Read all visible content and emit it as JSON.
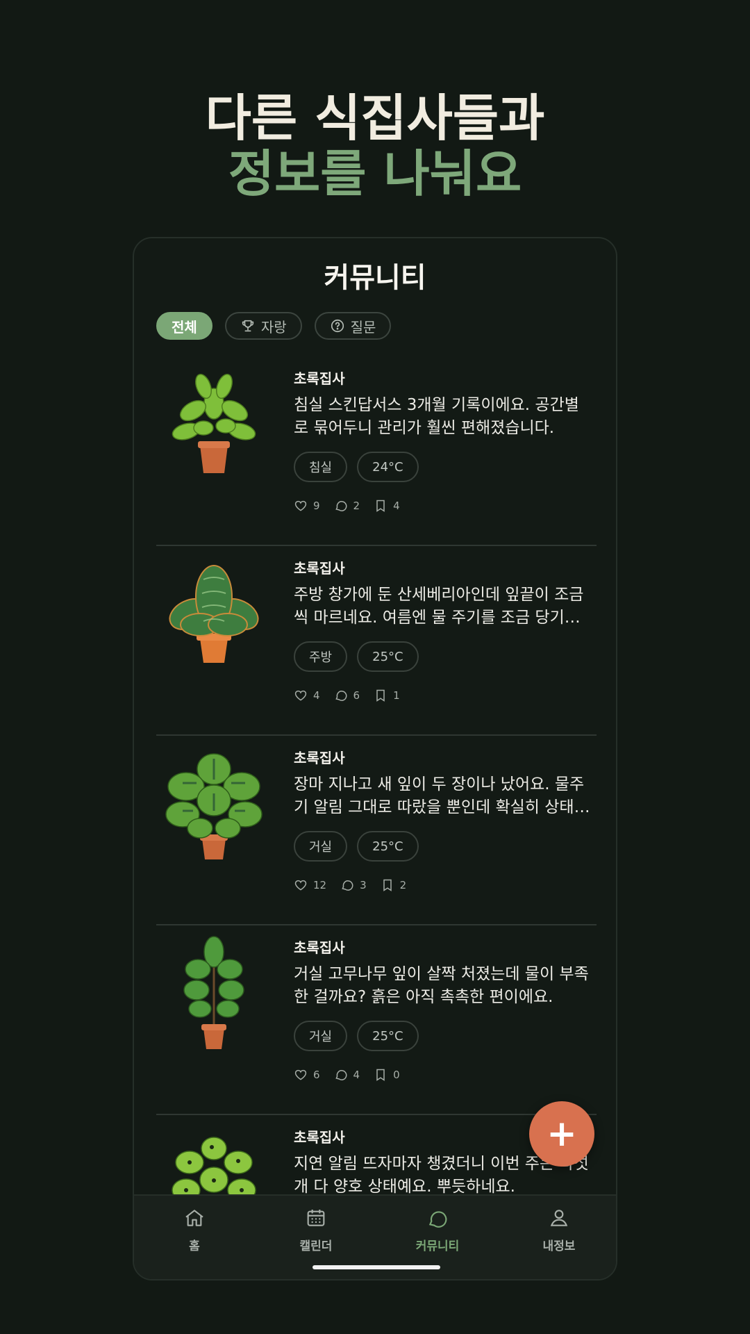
{
  "headline": {
    "line1": "다른 식집사들과",
    "line2": "정보를 나눠요"
  },
  "screen": {
    "title": "커뮤니티"
  },
  "filters": [
    {
      "label": "전체",
      "icon": "",
      "active": true
    },
    {
      "label": "자랑",
      "icon": "trophy-icon",
      "active": false
    },
    {
      "label": "질문",
      "icon": "question-icon",
      "active": false
    }
  ],
  "posts": [
    {
      "author": "초록집사",
      "body": "침실 스킨답서스 3개월 기록이에요. 공간별로 묶어두니 관리가 훨씬 편해졌습니다.",
      "tags": [
        "침실",
        "24°C"
      ],
      "likes": "9",
      "comments": "2",
      "bookmarks": "4",
      "image": "pothos-plant"
    },
    {
      "author": "초록집사",
      "body": "주방 창가에 둔 산세베리아인데 잎끝이 조금씩 마르네요. 여름엔 물 주기를 조금 당기는 게 ...",
      "tags": [
        "주방",
        "25°C"
      ],
      "likes": "4",
      "comments": "6",
      "bookmarks": "1",
      "image": "sansevieria-plant"
    },
    {
      "author": "초록집사",
      "body": "장마 지나고 새 잎이 두 장이나 났어요. 물주기 알림 그대로 따랐을 뿐인데 확실히 상태가 좋...",
      "tags": [
        "거실",
        "25°C"
      ],
      "likes": "12",
      "comments": "3",
      "bookmarks": "2",
      "image": "monstera-plant"
    },
    {
      "author": "초록집사",
      "body": "거실 고무나무 잎이 살짝 처졌는데 물이 부족한 걸까요? 흙은 아직 촉촉한 편이에요.",
      "tags": [
        "거실",
        "25°C"
      ],
      "likes": "6",
      "comments": "4",
      "bookmarks": "0",
      "image": "rubber-plant"
    },
    {
      "author": "초록집사",
      "body": "지연 알림 뜨자마자 챙겼더니 이번 주는 다섯 개 다 양호 상태예요. 뿌듯하네요.",
      "tags": [],
      "likes": "",
      "comments": "",
      "bookmarks": "",
      "image": "monstera-adansonii-plant"
    }
  ],
  "fab": {
    "label": "+"
  },
  "nav": [
    {
      "label": "홈",
      "icon": "home-icon",
      "active": false
    },
    {
      "label": "캘린더",
      "icon": "calendar-icon",
      "active": false
    },
    {
      "label": "커뮤니티",
      "icon": "chat-icon",
      "active": true
    },
    {
      "label": "내정보",
      "icon": "user-icon",
      "active": false
    }
  ],
  "colors": {
    "accent": "#7ba776",
    "fab": "#d8714f",
    "background": "#121914"
  }
}
